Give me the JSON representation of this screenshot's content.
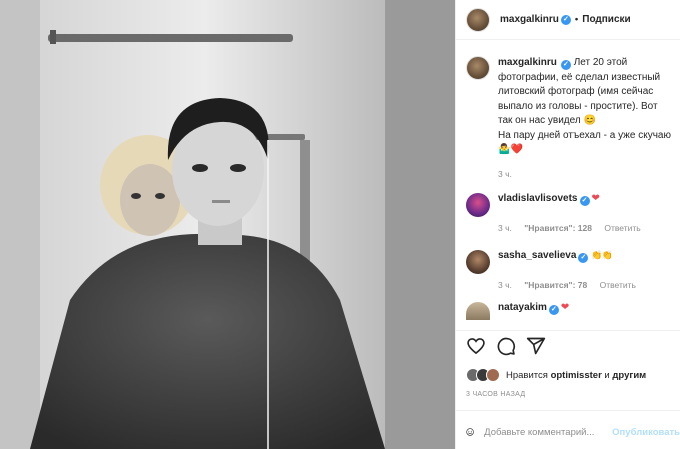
{
  "post": {
    "author": "maxgalkinru",
    "follow_label": "Подписки",
    "separator": "•",
    "verified_mark": "✓"
  },
  "caption": {
    "username": "maxgalkinru",
    "lines": [
      "Лет 20 этой",
      "фотографии, её сделал известный",
      "литовский фотограф (имя сейчас",
      "выпало из головы - простите). Вот",
      "так он нас увидел 😊",
      "На пару дней отъехал - а уже скучаю",
      "🤷‍♂️❤️"
    ],
    "age": "3 ч."
  },
  "comments": [
    {
      "username": "vladislavlisovets",
      "age": "3 ч.",
      "likes": "\"Нравится\": 128",
      "reply": "Ответить",
      "suffix": "❤"
    },
    {
      "username": "sasha_savelieva",
      "age": "3 ч.",
      "likes": "\"Нравится\": 78",
      "reply": "Ответить",
      "suffix": "👏👏"
    },
    {
      "username": "natayakim",
      "age": "",
      "likes": "",
      "reply": "",
      "suffix": "❤"
    }
  ],
  "likes_line": {
    "prefix": "Нравится",
    "user": "optimisster",
    "and": "и",
    "others": "другим"
  },
  "timestamp": "3 часов назад",
  "comment_input": {
    "placeholder": "Добавьте комментарий...",
    "publish": "Опубликовать"
  },
  "colors": {
    "verified": "#3897f0",
    "heart": "#ed4956",
    "publish_disabled": "#b2dffc",
    "muted": "#8e8e8e"
  },
  "icons": [
    "heart-icon",
    "comment-icon",
    "share-icon",
    "emoji-icon",
    "verified-badge"
  ]
}
